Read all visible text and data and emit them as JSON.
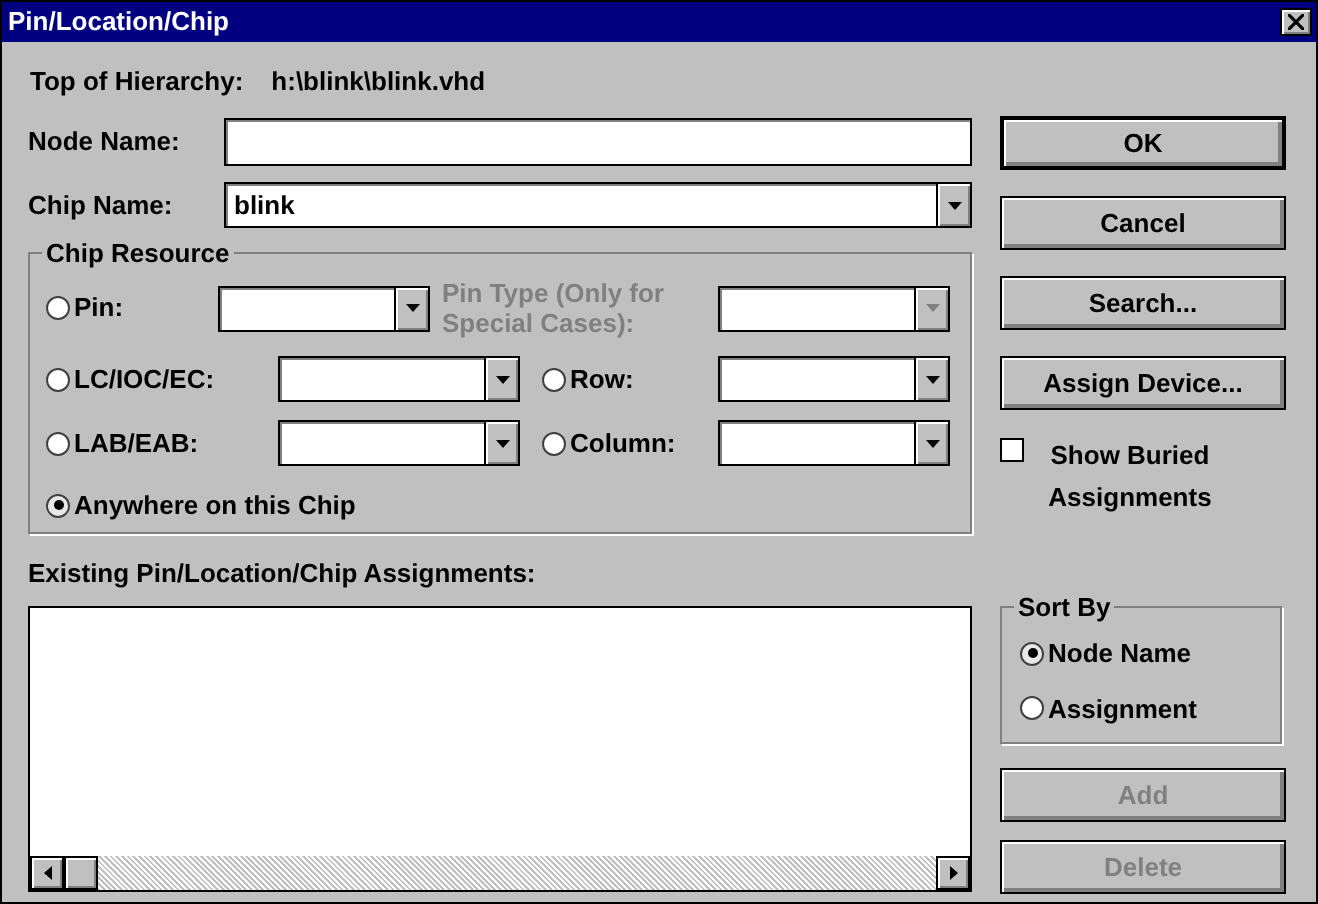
{
  "window": {
    "title": "Pin/Location/Chip"
  },
  "hierarchy": {
    "label": "Top of Hierarchy:",
    "value": "h:\\blink\\blink.vhd"
  },
  "node_name": {
    "label": "Node Name:"
  },
  "chip_name": {
    "label": "Chip Name:",
    "value": "blink"
  },
  "chip_resource": {
    "title": "Chip Resource",
    "pin": {
      "label": "Pin:",
      "selected": false
    },
    "pin_type": {
      "label": "Pin Type (Only for Special Cases):",
      "disabled": true
    },
    "lc": {
      "label": "LC/IOC/EC:",
      "selected": false
    },
    "row": {
      "label": "Row:",
      "selected": false
    },
    "lab": {
      "label": "LAB/EAB:",
      "selected": false
    },
    "column": {
      "label": "Column:",
      "selected": false
    },
    "anywhere": {
      "label": "Anywhere on this Chip",
      "selected": true
    }
  },
  "assignments": {
    "label": "Existing Pin/Location/Chip Assignments:"
  },
  "buttons": [
    {
      "label": "OK",
      "default": true,
      "disabled": false
    },
    {
      "label": "Cancel",
      "default": false,
      "disabled": false
    },
    {
      "label": "Search...",
      "default": false,
      "disabled": false
    },
    {
      "label": "Assign Device...",
      "default": false,
      "disabled": false
    }
  ],
  "show_buried": {
    "label": "Show Buried Assignments",
    "checked": false
  },
  "sort_by": {
    "title": "Sort By",
    "options": [
      {
        "label": "Node Name",
        "selected": true
      },
      {
        "label": "Assignment",
        "selected": false
      }
    ]
  },
  "list_buttons": [
    {
      "label": "Add",
      "default": false,
      "disabled": true
    },
    {
      "label": "Delete",
      "default": false,
      "disabled": true
    }
  ]
}
